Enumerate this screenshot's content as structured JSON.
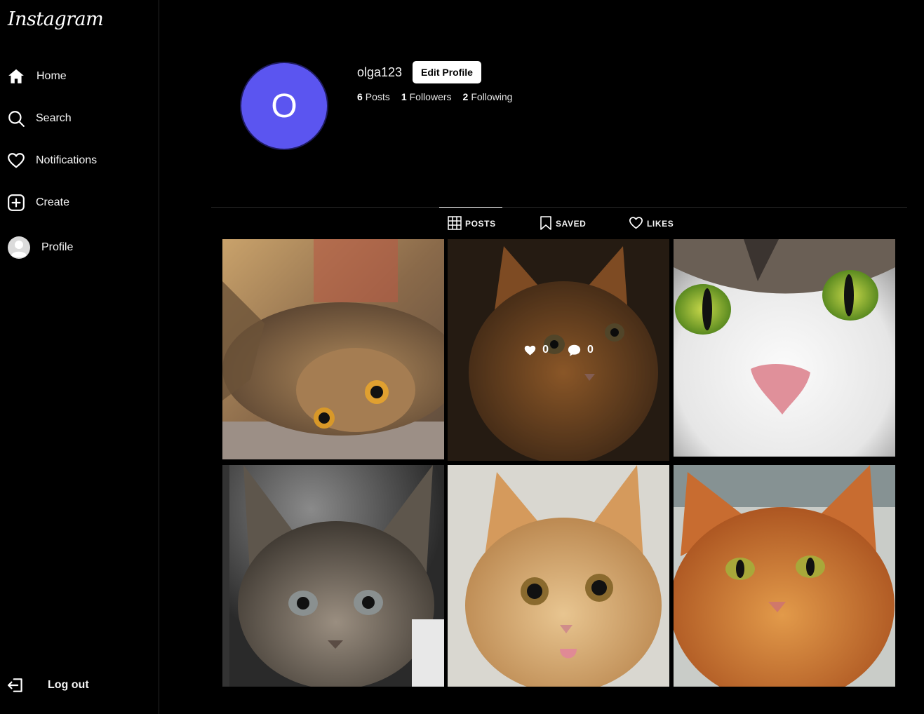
{
  "app": {
    "logo_text": "Instagram"
  },
  "sidebar": {
    "items": [
      {
        "key": "home",
        "label": "Home",
        "icon": "home-icon"
      },
      {
        "key": "search",
        "label": "Search",
        "icon": "search-icon"
      },
      {
        "key": "notifications",
        "label": "Notifications",
        "icon": "heart-icon"
      },
      {
        "key": "create",
        "label": "Create",
        "icon": "plus-square-icon"
      },
      {
        "key": "profile",
        "label": "Profile",
        "icon": "user-avatar-icon"
      }
    ],
    "logout_label": "Log out"
  },
  "profile": {
    "avatar_initial": "O",
    "avatar_color": "#5b55f0",
    "username": "olga123",
    "edit_label": "Edit Profile",
    "posts_count": "6",
    "posts_label": "Posts",
    "followers_count": "1",
    "followers_label": "Followers",
    "following_count": "2",
    "following_label": "Following"
  },
  "tabs": [
    {
      "label": "POSTS",
      "icon": "grid-icon",
      "active": true
    },
    {
      "label": "SAVED",
      "icon": "bookmark-icon",
      "active": false
    },
    {
      "label": "LIKES",
      "icon": "heart-outline-icon",
      "active": false
    }
  ],
  "posts": [
    {
      "subject": "tabby cat lying on its side",
      "likes": "",
      "comments": ""
    },
    {
      "subject": "orange tabby cat",
      "likes": "0",
      "comments": "0",
      "hovered": true
    },
    {
      "subject": "white cat face with green eyes",
      "likes": "",
      "comments": ""
    },
    {
      "subject": "gray tabby kitten",
      "likes": "",
      "comments": ""
    },
    {
      "subject": "orange kitten with tongue out",
      "likes": "",
      "comments": ""
    },
    {
      "subject": "orange tabby cat with green eyes",
      "likes": "",
      "comments": ""
    }
  ]
}
